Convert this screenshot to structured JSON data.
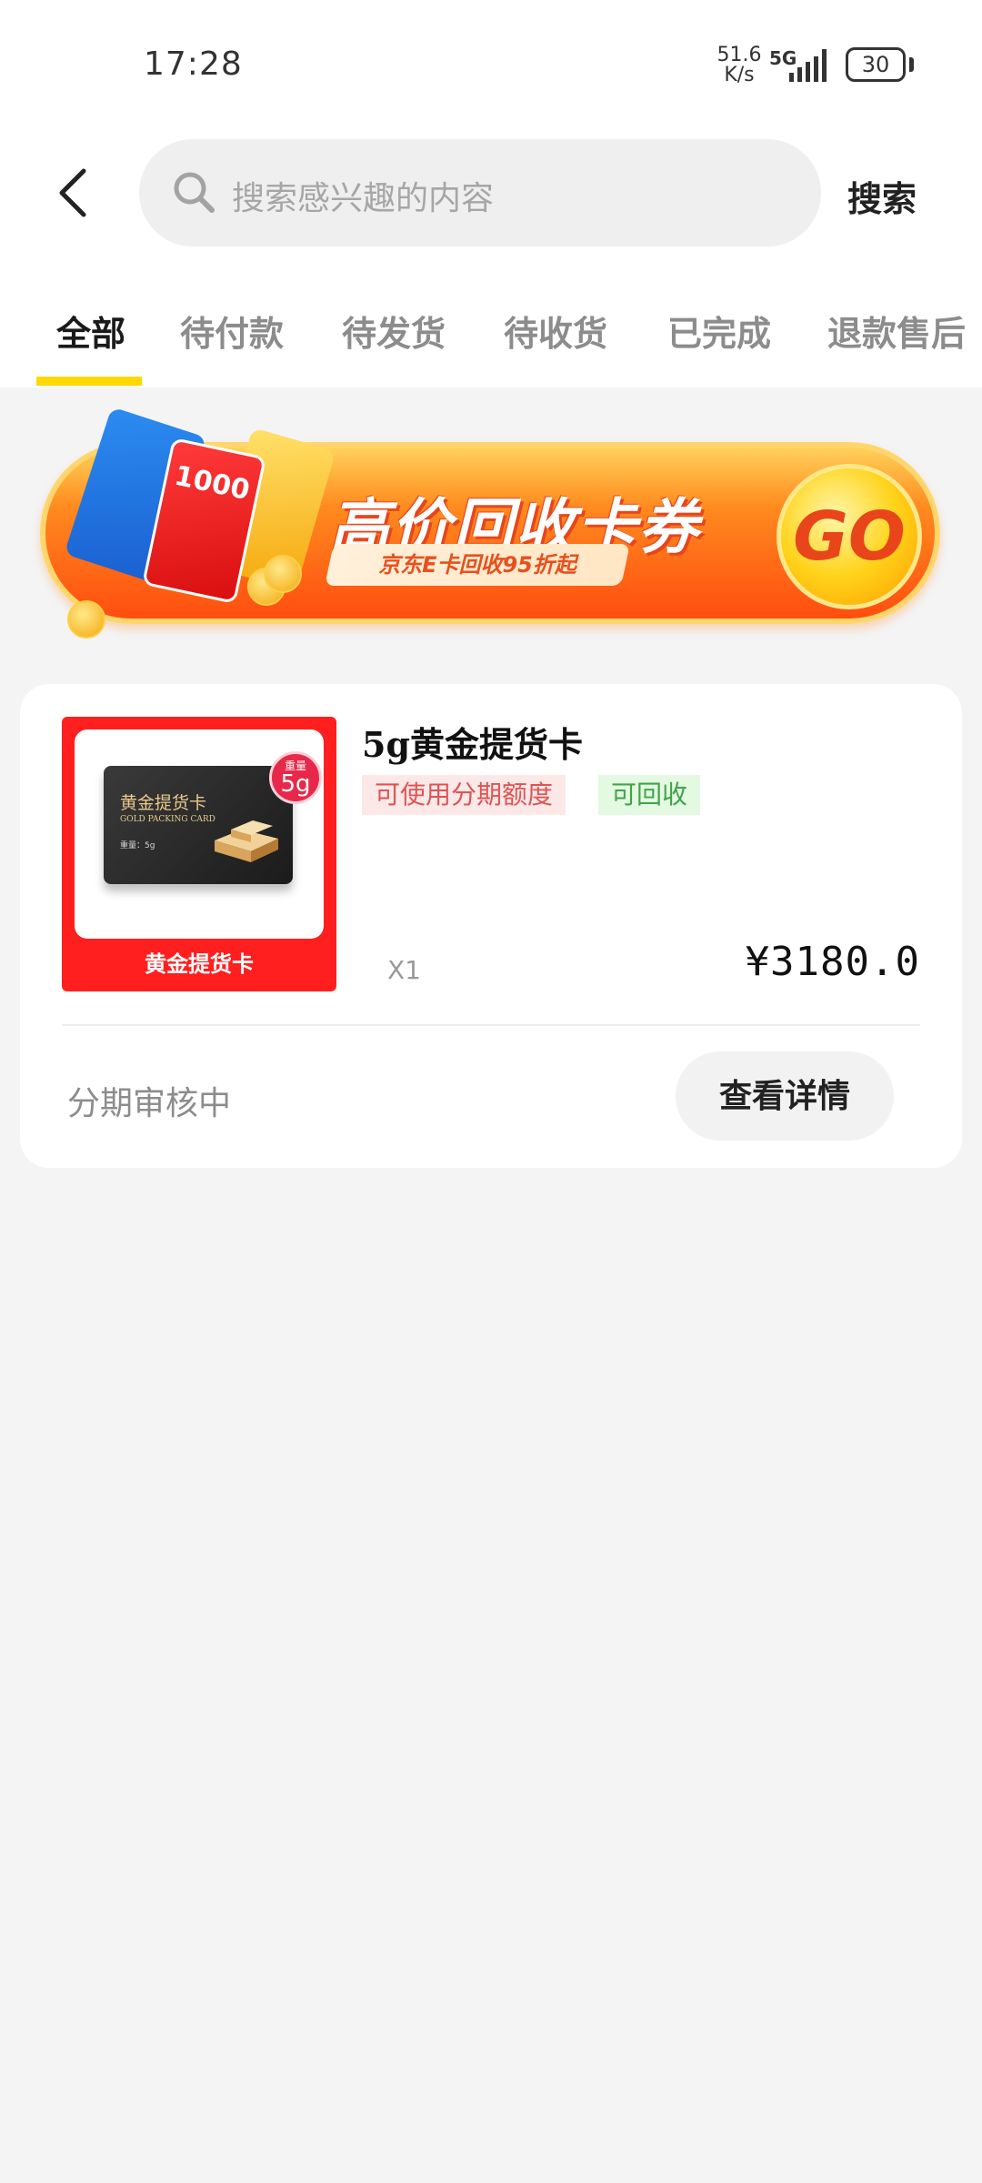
{
  "status_bar": {
    "time": "17:28",
    "net_speed": "51.6 K/s",
    "network": "5G",
    "battery": "30",
    "icons": [
      "signal-icon",
      "battery-icon"
    ]
  },
  "header": {
    "back_icon": "chevron-left-icon",
    "search_icon": "search-icon",
    "search_placeholder": "搜索感兴趣的内容",
    "search_button": "搜索"
  },
  "tabs": [
    {
      "label": "全部",
      "active": true
    },
    {
      "label": "待付款",
      "active": false
    },
    {
      "label": "待发货",
      "active": false
    },
    {
      "label": "待收货",
      "active": false
    },
    {
      "label": "已完成",
      "active": false
    },
    {
      "label": "退款售后",
      "active": false
    }
  ],
  "banner": {
    "title": "高价回收卡券",
    "subtitle": "京东E卡回收95折起",
    "go_label": "GO",
    "card_text": "1000"
  },
  "order": {
    "product_image_label": "黄金提货卡",
    "product_image_card_title": "黄金提货卡",
    "product_image_card_en": "GOLD PACKING CARD",
    "product_image_card_weight": "重量：5g",
    "product_image_badge_small": "重量",
    "product_image_badge_large": "5g",
    "product_name": "5g黄金提货卡",
    "tags": [
      "可使用分期额度",
      "可回收"
    ],
    "quantity": "X1",
    "price": "¥3180.0",
    "status": "分期审核中",
    "detail_button": "查看详情"
  },
  "colors": {
    "accent": "#ffd800",
    "banner_orange": "#ff4e0f",
    "product_red": "#ff1f1f"
  }
}
